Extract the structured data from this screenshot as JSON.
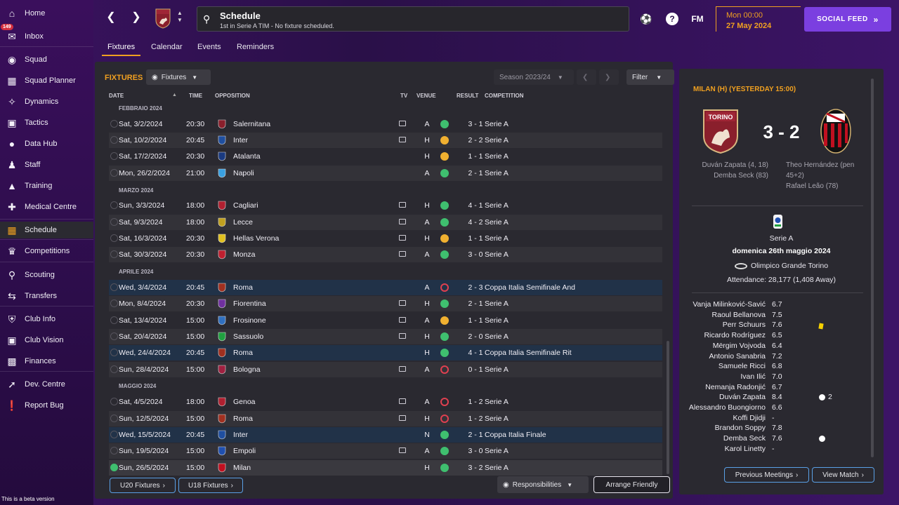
{
  "sidebar": {
    "items": [
      {
        "label": "Home",
        "icon": "home-icon"
      },
      {
        "label": "Inbox",
        "icon": "inbox-icon",
        "badge": "149"
      },
      {
        "label": "Squad",
        "icon": "shirt-icon"
      },
      {
        "label": "Squad Planner",
        "icon": "clipboard-icon"
      },
      {
        "label": "Dynamics",
        "icon": "dynamics-icon"
      },
      {
        "label": "Tactics",
        "icon": "tactics-icon"
      },
      {
        "label": "Data Hub",
        "icon": "data-hub-icon"
      },
      {
        "label": "Staff",
        "icon": "staff-icon"
      },
      {
        "label": "Training",
        "icon": "training-icon"
      },
      {
        "label": "Medical Centre",
        "icon": "medical-icon"
      },
      {
        "label": "Schedule",
        "icon": "calendar-icon"
      },
      {
        "label": "Competitions",
        "icon": "trophy-icon"
      },
      {
        "label": "Scouting",
        "icon": "scouting-icon"
      },
      {
        "label": "Transfers",
        "icon": "transfers-icon"
      },
      {
        "label": "Club Info",
        "icon": "shield-icon"
      },
      {
        "label": "Club Vision",
        "icon": "briefcase-icon"
      },
      {
        "label": "Finances",
        "icon": "finances-icon"
      },
      {
        "label": "Dev. Centre",
        "icon": "dev-centre-icon"
      },
      {
        "label": "Report Bug",
        "icon": "alert-icon"
      }
    ],
    "beta_text": "This is a beta version"
  },
  "header": {
    "title": "Schedule",
    "subtitle": "1st in Serie A TIM - No fixture scheduled.",
    "fm_label": "FM",
    "time": "Mon 00:00",
    "date": "27 May 2024",
    "social_feed": "SOCIAL FEED"
  },
  "tabs": [
    "Fixtures",
    "Calendar",
    "Events",
    "Reminders"
  ],
  "fixtures": {
    "title": "FIXTURES",
    "filter_dropdown": "Fixtures",
    "season": "Season 2023/24",
    "filter": "Filter",
    "columns": {
      "date": "DATE",
      "time": "TIME",
      "opposition": "OPPOSITION",
      "tv": "TV",
      "venue": "VENUE",
      "result": "RESULT",
      "competition": "COMPETITION"
    },
    "months": [
      "FEBBRAIO 2024",
      "MARZO 2024",
      "APRILE 2024",
      "MAGGIO 2024"
    ],
    "rows": [
      {
        "date": "Sat, 3/2/2024",
        "time": "20:30",
        "opp": "Salernitana",
        "tv": true,
        "venue": "A",
        "res": "w",
        "score": "3 - 1",
        "comp": "Serie A",
        "crest": "#8a1f2c"
      },
      {
        "date": "Sat, 10/2/2024",
        "time": "20:45",
        "opp": "Inter",
        "tv": true,
        "venue": "H",
        "res": "d",
        "score": "2 - 2",
        "comp": "Serie A",
        "crest": "#1f4fa0"
      },
      {
        "date": "Sat, 17/2/2024",
        "time": "20:30",
        "opp": "Atalanta",
        "tv": false,
        "venue": "H",
        "res": "d",
        "score": "1 - 1",
        "comp": "Serie A",
        "crest": "#1a3a80"
      },
      {
        "date": "Mon, 26/2/2024",
        "time": "21:00",
        "opp": "Napoli",
        "tv": false,
        "venue": "A",
        "res": "w",
        "score": "2 - 1",
        "comp": "Serie A",
        "crest": "#3aa0e0"
      },
      {
        "date": "Sun, 3/3/2024",
        "time": "18:00",
        "opp": "Cagliari",
        "tv": true,
        "venue": "H",
        "res": "w",
        "score": "4 - 1",
        "comp": "Serie A",
        "crest": "#b02030"
      },
      {
        "date": "Sat, 9/3/2024",
        "time": "18:00",
        "opp": "Lecce",
        "tv": true,
        "venue": "A",
        "res": "w",
        "score": "4 - 2",
        "comp": "Serie A",
        "crest": "#c0a020"
      },
      {
        "date": "Sat, 16/3/2024",
        "time": "20:30",
        "opp": "Hellas Verona",
        "tv": true,
        "venue": "H",
        "res": "d",
        "score": "1 - 1",
        "comp": "Serie A",
        "crest": "#e0c020"
      },
      {
        "date": "Sat, 30/3/2024",
        "time": "20:30",
        "opp": "Monza",
        "tv": true,
        "venue": "A",
        "res": "w",
        "score": "3 - 0",
        "comp": "Serie A",
        "crest": "#c02030"
      },
      {
        "date": "Wed, 3/4/2024",
        "time": "20:45",
        "opp": "Roma",
        "tv": false,
        "venue": "A",
        "res": "l",
        "score": "2 - 3",
        "comp": "Coppa Italia Semifinale And",
        "crest": "#a03020"
      },
      {
        "date": "Mon, 8/4/2024",
        "time": "20:30",
        "opp": "Fiorentina",
        "tv": true,
        "venue": "H",
        "res": "w",
        "score": "2 - 1",
        "comp": "Serie A",
        "crest": "#7030a0"
      },
      {
        "date": "Sat, 13/4/2024",
        "time": "15:00",
        "opp": "Frosinone",
        "tv": true,
        "venue": "A",
        "res": "d",
        "score": "1 - 1",
        "comp": "Serie A",
        "crest": "#3070c0"
      },
      {
        "date": "Sat, 20/4/2024",
        "time": "15:00",
        "opp": "Sassuolo",
        "tv": true,
        "venue": "H",
        "res": "w",
        "score": "2 - 0",
        "comp": "Serie A",
        "crest": "#20a040"
      },
      {
        "date": "Wed, 24/4/2024",
        "time": "20:45",
        "opp": "Roma",
        "tv": false,
        "venue": "H",
        "res": "w",
        "score": "4 - 1",
        "comp": "Coppa Italia Semifinale Rit",
        "crest": "#a03020"
      },
      {
        "date": "Sun, 28/4/2024",
        "time": "15:00",
        "opp": "Bologna",
        "tv": true,
        "venue": "A",
        "res": "l",
        "score": "0 - 1",
        "comp": "Serie A",
        "crest": "#a02040"
      },
      {
        "date": "Sat, 4/5/2024",
        "time": "18:00",
        "opp": "Genoa",
        "tv": true,
        "venue": "A",
        "res": "l",
        "score": "1 - 2",
        "comp": "Serie A",
        "crest": "#b02030"
      },
      {
        "date": "Sun, 12/5/2024",
        "time": "15:00",
        "opp": "Roma",
        "tv": true,
        "venue": "H",
        "res": "l",
        "score": "1 - 2",
        "comp": "Serie A",
        "crest": "#a03020"
      },
      {
        "date": "Wed, 15/5/2024",
        "time": "20:45",
        "opp": "Inter",
        "tv": false,
        "venue": "N",
        "res": "w",
        "score": "2 - 1",
        "comp": "Coppa Italia Finale",
        "crest": "#1f4fa0"
      },
      {
        "date": "Sun, 19/5/2024",
        "time": "15:00",
        "opp": "Empoli",
        "tv": true,
        "venue": "A",
        "res": "w",
        "score": "3 - 0",
        "comp": "Serie A",
        "crest": "#2050b0"
      },
      {
        "date": "Sun, 26/5/2024",
        "time": "15:00",
        "opp": "Milan",
        "tv": false,
        "venue": "H",
        "res": "w",
        "score": "3 - 2",
        "comp": "Serie A",
        "crest": "#c01020"
      }
    ],
    "u20": "U20 Fixtures",
    "u18": "U18 Fixtures",
    "responsibilities": "Responsibilities",
    "arrange_friendly": "Arrange Friendly"
  },
  "match": {
    "title": "MILAN (H) (YESTERDAY 15:00)",
    "score": "3 - 2",
    "home_crest_text": "TORINO",
    "home_scorers": [
      "Duván Zapata (4, 18)",
      "Demba Seck (83)"
    ],
    "away_scorers": [
      "Theo Hernández (pen",
      "45+2)",
      "Rafael Leão (78)"
    ],
    "competition": "Serie A",
    "date": "domenica 26th maggio 2024",
    "stadium": "Olimpico Grande Torino",
    "attendance": "Attendance: 28,177 (1,408 Away)",
    "players": [
      {
        "name": "Vanja Milinković-Savić",
        "rating": "6.7"
      },
      {
        "name": "Raoul Bellanova",
        "rating": "7.5"
      },
      {
        "name": "Perr Schuurs",
        "rating": "7.6"
      },
      {
        "name": "Ricardo Rodríguez",
        "rating": "6.5"
      },
      {
        "name": "Mërgim Vojvoda",
        "rating": "6.4"
      },
      {
        "name": "Antonio Sanabria",
        "rating": "7.2"
      },
      {
        "name": "Samuele Ricci",
        "rating": "6.8"
      },
      {
        "name": "Ivan Ilić",
        "rating": "7.0"
      },
      {
        "name": "Nemanja Radonjić",
        "rating": "6.7"
      },
      {
        "name": "Duván Zapata",
        "rating": "8.4"
      },
      {
        "name": "Alessandro Buongiorno",
        "rating": "6.6"
      },
      {
        "name": "Koffi Djidji",
        "rating": "-"
      },
      {
        "name": "Brandon Soppy",
        "rating": "7.8"
      },
      {
        "name": "Demba Seck",
        "rating": "7.6"
      },
      {
        "name": "Karol Linetty",
        "rating": "-"
      }
    ],
    "zapata_goals": "2",
    "prev_meetings": "Previous Meetings",
    "view_match": "View Match"
  },
  "colors": {
    "accent": "#f0a020",
    "win": "#3fbf6f",
    "draw": "#f0b030",
    "loss": "#e04050",
    "social": "#7b3fe0"
  }
}
